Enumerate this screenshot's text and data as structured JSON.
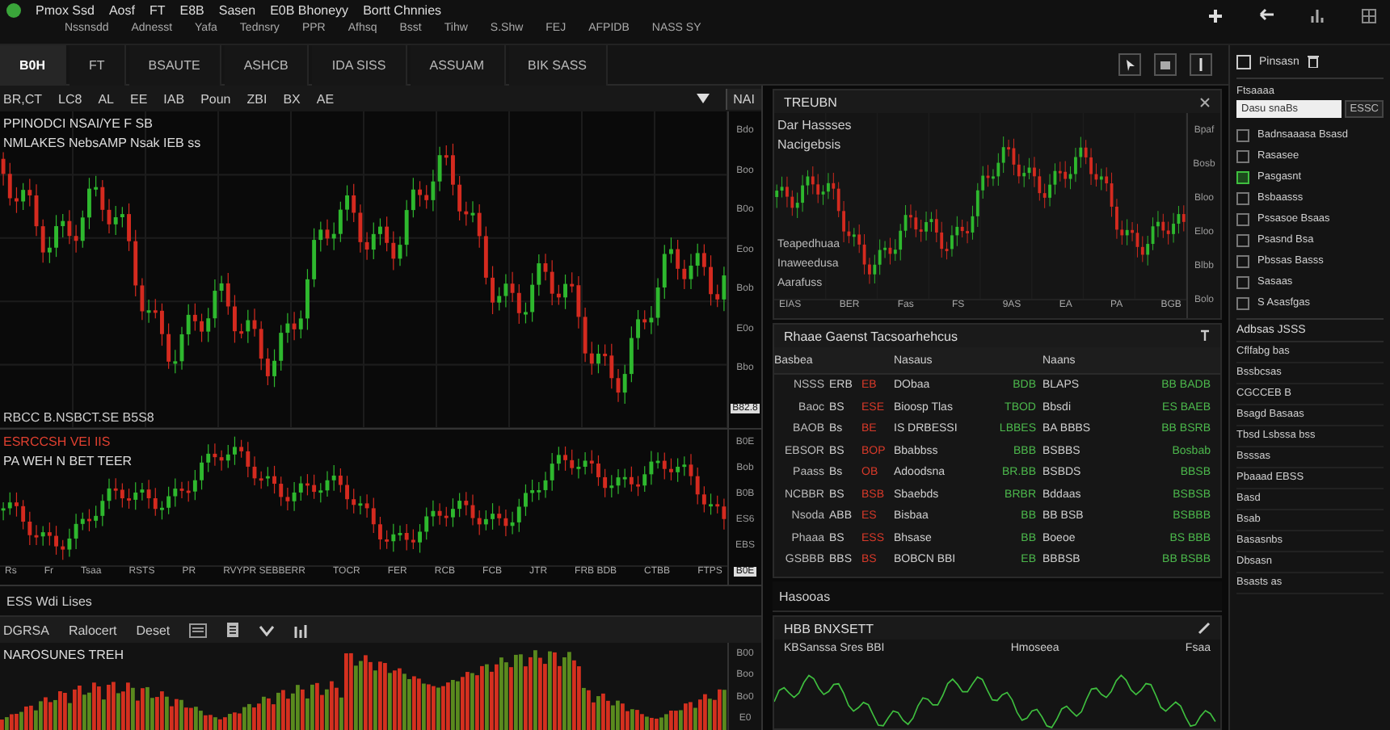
{
  "menu_bar": {
    "items": [
      "Pmox Ssd",
      "Aosf",
      "FT",
      "E8B",
      "Sasen",
      "E0B Bhoneyy",
      "Bortt Chnnies"
    ],
    "sub_items": [
      "Nssnsdd",
      "Adnesst",
      "Yafa",
      "Tednsry",
      "PPR",
      "Afhsq",
      "Bsst",
      "Tihw",
      "S.Shw",
      "FEJ",
      "AFPIDB",
      "NASS SY"
    ]
  },
  "tabs": [
    {
      "label": "B0H",
      "selected": true
    },
    {
      "label": "FT",
      "selected": false
    },
    {
      "label": "BSAUTE",
      "selected": false
    },
    {
      "label": "ASHCB",
      "selected": false
    },
    {
      "label": "IDA SISS",
      "selected": false
    },
    {
      "label": "ASSUAM",
      "selected": false
    },
    {
      "label": "BIK SASS",
      "selected": false
    }
  ],
  "main_chart": {
    "toolbar": [
      "BR,CT",
      "LC8",
      "AL",
      "EE",
      "IAB",
      "Poun",
      "ZBI",
      "BX",
      "AE"
    ],
    "side_label": "NAI",
    "legend": [
      "PPINODCI NSAI/YE F SB",
      "NMLAKES NebsAMP Nsak IEB ss"
    ],
    "y_labels": [
      "Bdo",
      "Boo",
      "B0o",
      "Eoo",
      "Bob",
      "E0o",
      "Bbo"
    ],
    "price_tag": "B82.8",
    "footer": "RBCC B.NSBCT.SE B5S8"
  },
  "sub_chart": {
    "legend": [
      "ESRCCSH VEI IIS",
      "PA WEH N BET TEER"
    ],
    "y_labels": [
      "B0E",
      "Bob",
      "B0B",
      "ES6",
      "EBS"
    ],
    "price_tag": "B0E",
    "x_labels": [
      "Rs",
      "Fr",
      "Tsaa",
      "RSTS",
      "PR",
      "RVYPR SEBBERR",
      "TOCR",
      "FER",
      "RCB",
      "FCB",
      "JTR",
      "FRB BDB",
      "CTBB",
      "FTPS"
    ]
  },
  "list_row": "ESS Wdi Lises",
  "volume_panel": {
    "toolbar": [
      "DGRSA",
      "Ralocert",
      "Deset"
    ],
    "title": "NAROSUNES TREH",
    "y_labels": [
      "B00",
      "Boo",
      "Bo0",
      "E0"
    ]
  },
  "mini_chart": {
    "title": "TREUBN",
    "legend": [
      "Dar Hassses",
      "Nacigebsis"
    ],
    "notes": [
      "Teapedhuaa",
      "Inaweedusa",
      "Aarafuss"
    ],
    "y_labels": [
      "Bpaf",
      "Bosb",
      "Bloo",
      "Eloo",
      "Blbb",
      "Bolo"
    ],
    "x_labels": [
      "EIAS",
      "BER",
      "Fas",
      "FS",
      "9AS",
      "EA",
      "PA",
      "BGB"
    ]
  },
  "table": {
    "title": "Rhaae Gaenst Tacsoarhehcus",
    "columns": [
      "Basbea",
      "",
      "",
      "Nasaus",
      "",
      "Naans",
      ""
    ],
    "rows": [
      [
        "NSSS",
        "ERB",
        "EB",
        "DObaa",
        "BDB",
        "BLAPS",
        "BB BADB"
      ],
      [
        "Baoc",
        "BS",
        "ESE",
        "Bioosp Tlas",
        "TBOD",
        "Bbsdi",
        "ES BAEB"
      ],
      [
        "BAOB",
        "Bs",
        "BE",
        "IS DRBESSI",
        "LBBES",
        "BA BBBS",
        "BB BSRB"
      ],
      [
        "EBSOR",
        "BS",
        "BOP",
        "Bbabbss",
        "BBB",
        "BSBBS",
        "Bosbab"
      ],
      [
        "Paass",
        "Bs",
        "OB",
        "Adoodsna",
        "BR.BB",
        "BSBDS",
        "BBSB"
      ],
      [
        "NCBBR",
        "BS",
        "BSB",
        "Sbaebds",
        "BRBR",
        "Bddaas",
        "BSBSB"
      ],
      [
        "Nsoda",
        "ABB",
        "ES",
        "Bisbaa",
        "BB",
        "BB BSB",
        "BSBBB"
      ],
      [
        "Phaaa",
        "BS",
        "ESS",
        "Bhsase",
        "BB",
        "Boeoe",
        "BS BBB"
      ],
      [
        "GSBBB",
        "BBS",
        "BS",
        "BOBCN BBI",
        "EB",
        "BBBSB",
        "BB BSBB"
      ]
    ]
  },
  "status_row": "Hasooas",
  "bottom_panel": {
    "title": "HBB BNXSETT",
    "headers": [
      "KBSanssa Sres BBI",
      "Hmoseea",
      "Fsaa"
    ]
  },
  "sidebar": {
    "title": "Pinsasn",
    "field_label": "Ftsaaaa",
    "field_value": "Dasu snaBs",
    "field_button": "ESSC",
    "items": [
      {
        "label": "Badnsaaasa Bsasd",
        "checked": false
      },
      {
        "label": "Rasasee",
        "checked": false
      },
      {
        "label": "Pasgasnt",
        "checked": true
      },
      {
        "label": "Bsbaasss",
        "checked": false
      },
      {
        "label": "Pssasoe Bsaas",
        "checked": false
      },
      {
        "label": "Psasnd Bsa",
        "checked": false
      },
      {
        "label": "Pbssas Basss",
        "checked": false
      },
      {
        "label": "Sasaas",
        "checked": false
      },
      {
        "label": "S Asasfgas",
        "checked": false
      }
    ],
    "section": "Adbsas JSSS",
    "section_items": [
      "Cflfabg bas",
      "Bssbcsas",
      "CGCCEB B",
      "Bsagd Basaas",
      "Tbsd Lsbssa bss",
      "Bsssas",
      "Pbaaad EBSS",
      "Basd",
      "Bsab",
      "Basasnbs",
      "Dbsasn",
      "Bsasts as"
    ]
  }
}
